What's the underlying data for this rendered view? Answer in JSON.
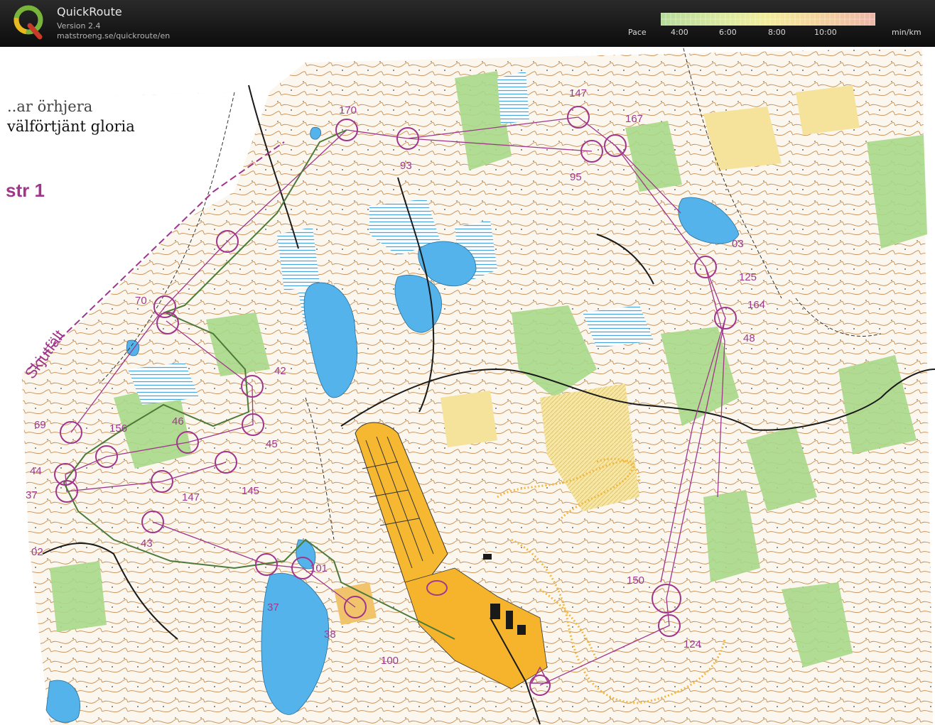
{
  "app": {
    "title": "QuickRoute",
    "version": "Version 2.4",
    "url": "matstroeng.se/quickroute/en",
    "icon": "quickroute-q-logo"
  },
  "pace_scale": {
    "label": "Pace",
    "ticks": [
      "4:00",
      "6:00",
      "8:00",
      "10:00"
    ],
    "unit": "min/km",
    "colors": [
      "#b6dc9a",
      "#dcea9e",
      "#f2ec9a",
      "#f5d59c",
      "#eeb5a8"
    ]
  },
  "map": {
    "text_lines": [
      "välförtjänt gloria",
      "str 1",
      "Skjutfält"
    ],
    "partial_text": "..ar örhjera",
    "controls": [
      "170",
      "93",
      "147",
      "167",
      "95",
      "03",
      "125",
      "164",
      "48",
      "70",
      "42",
      "69",
      "156",
      "46",
      "45",
      "44",
      "37",
      "147",
      "145",
      "43",
      "02",
      "101",
      "37",
      "38",
      "100",
      "150",
      "124"
    ],
    "colors": {
      "water": "#5bb6e8",
      "forest_green": "#9ed27c",
      "open_yellow": "#f5c030",
      "contour": "#b87a3c",
      "course": "#a0368c",
      "route": "#4d7a3a"
    }
  }
}
